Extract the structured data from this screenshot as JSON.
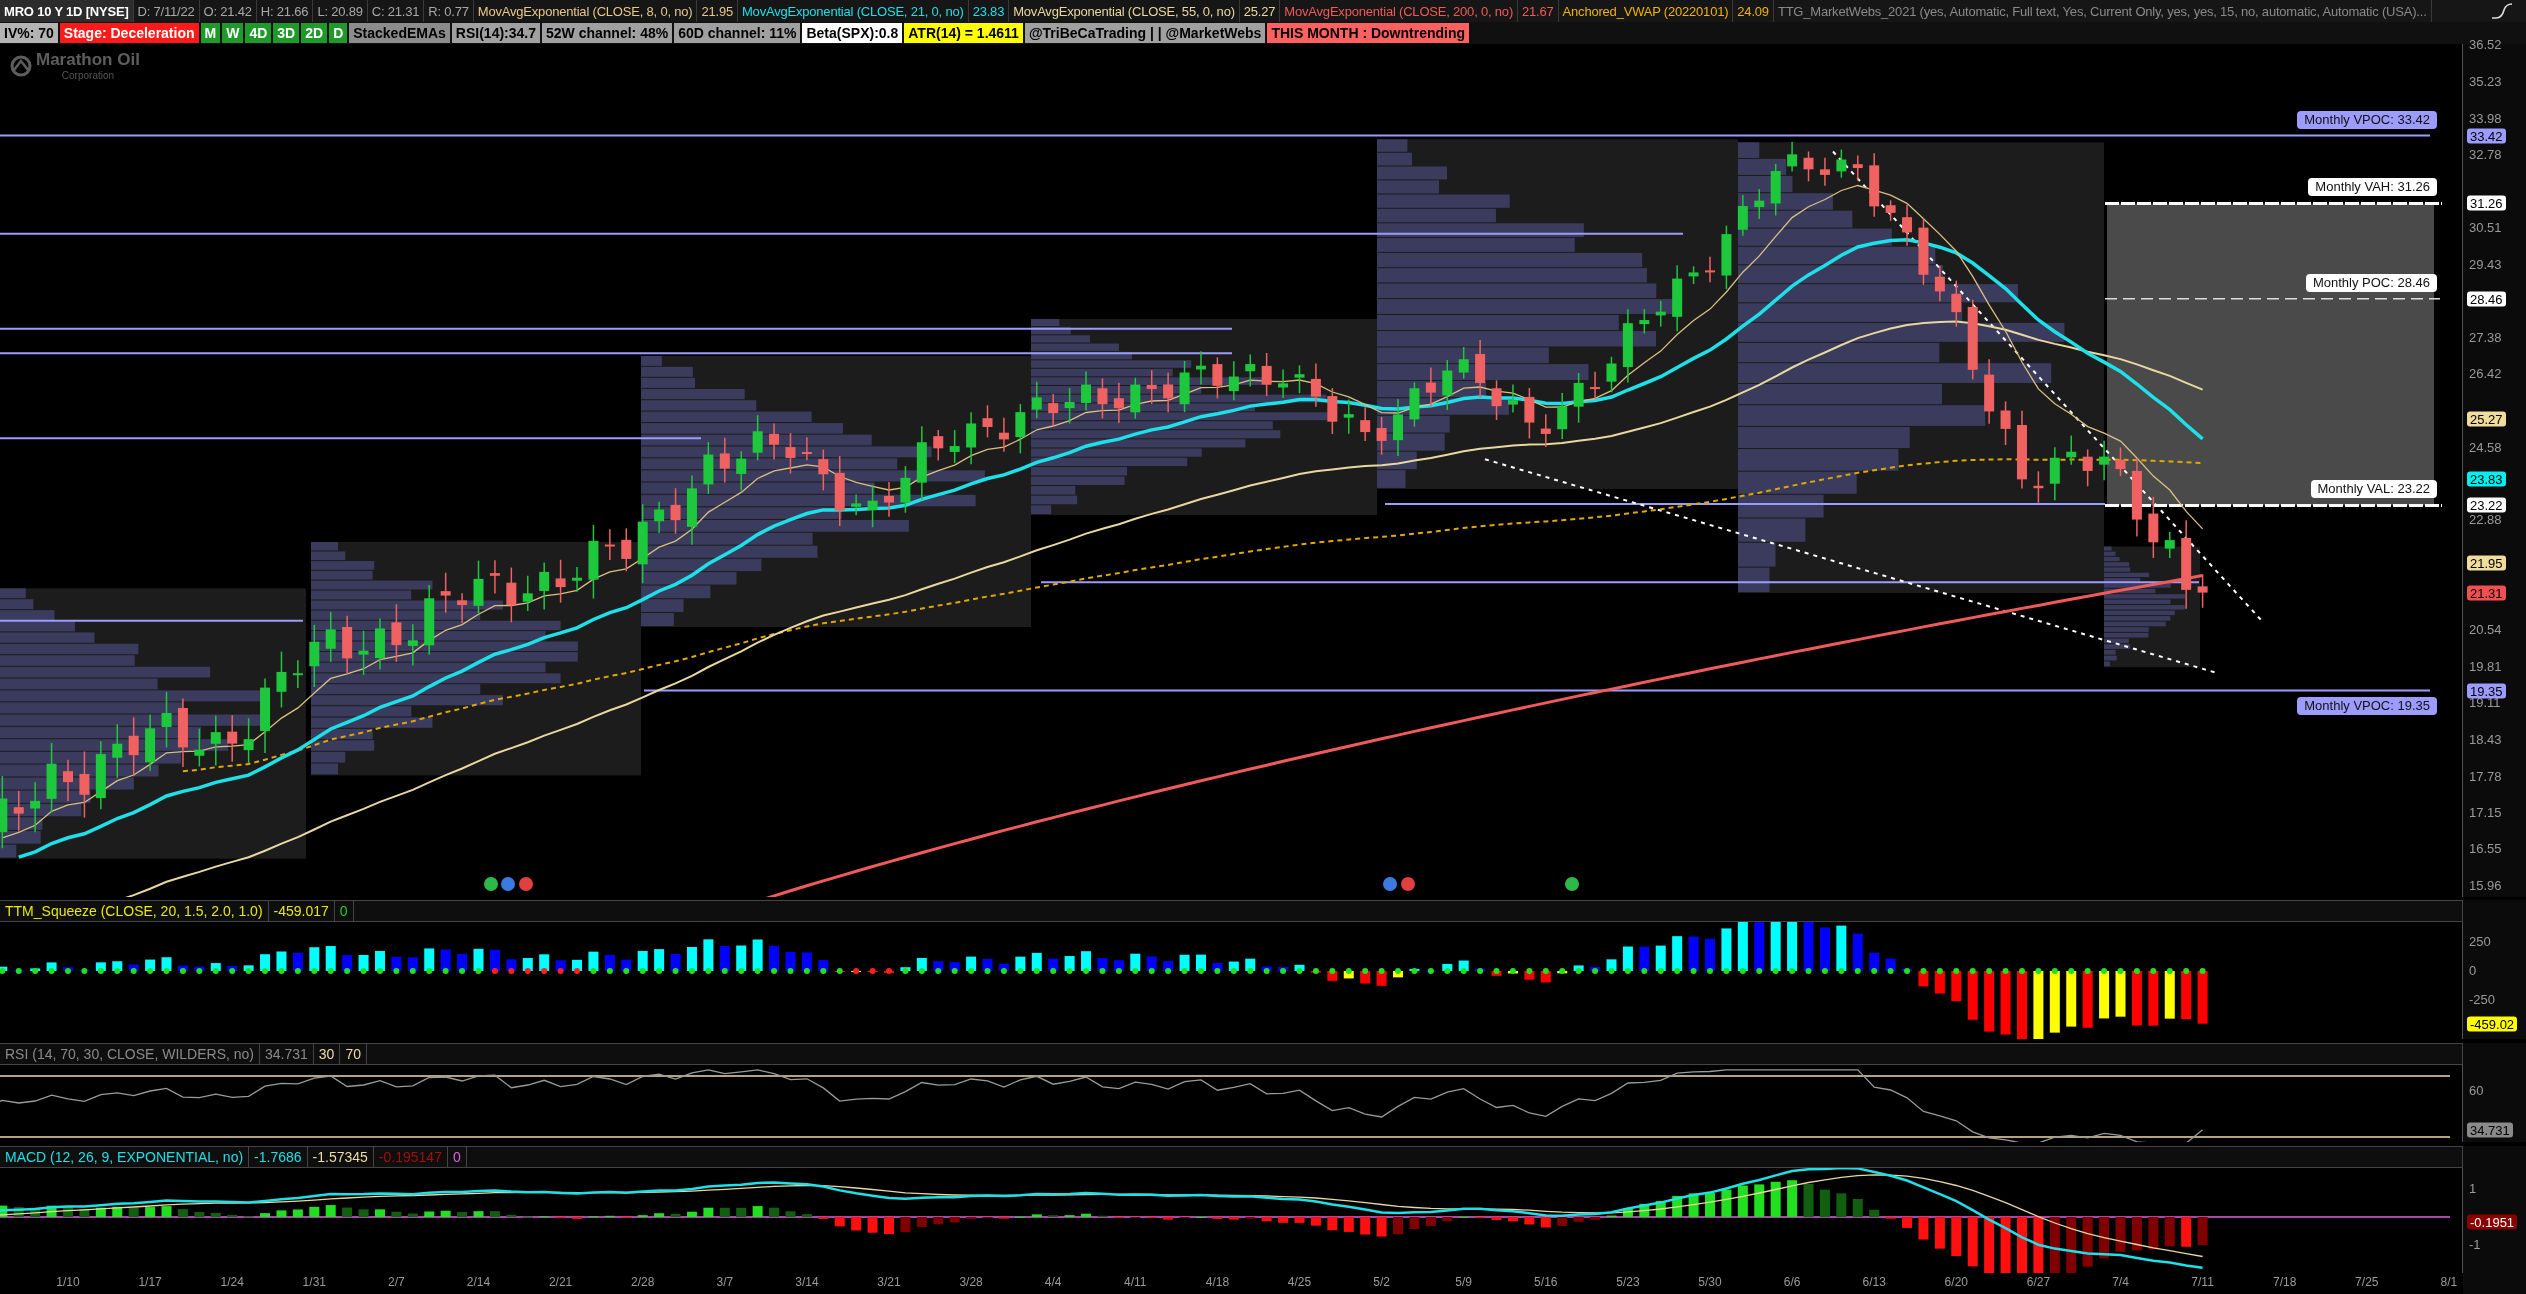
{
  "header": {
    "symbol": "MRO 10 Y 1D [NYSE]",
    "quote": [
      "D: 7/11/22",
      "O: 21.42",
      "H: 21.66",
      "L: 20.89",
      "C: 21.31",
      "R: 0.77"
    ],
    "studies": [
      {
        "label": "MovAvgExponential (CLOSE, 8, 0, no)",
        "value": "21.95",
        "color": "#e6c88a"
      },
      {
        "label": "MovAvgExponential (CLOSE, 21, 0, no)",
        "value": "23.83",
        "color": "#1ee0e8"
      },
      {
        "label": "MovAvgExponential (CLOSE, 55, 0, no)",
        "value": "25.27",
        "color": "#e8d8a0"
      },
      {
        "label": "MovAvgExponential (CLOSE, 200, 0, no)",
        "value": "21.67",
        "color": "#f05a5a"
      },
      {
        "label": "Anchored_VWAP (20220101)",
        "value": "24.09",
        "color": "#f0b400"
      },
      {
        "label": "TTG_MarketWebs_2021 (yes, Automatic, Full text, Yes, Current Only, yes, yes, 15, no, automatic, Automatic (USA)...",
        "color": "#8a8a8a"
      }
    ],
    "badges": [
      {
        "text": "IV%: 70",
        "color": "#b4b4b4"
      },
      {
        "text": "Stage: Deceleration",
        "color": "#ff1a1a"
      },
      {
        "text": "M",
        "color": "#1f9a2a"
      },
      {
        "text": "W",
        "color": "#1f9a2a"
      },
      {
        "text": "4D",
        "color": "#1f9a2a"
      },
      {
        "text": "3D",
        "color": "#1f9a2a"
      },
      {
        "text": "2D",
        "color": "#1f9a2a"
      },
      {
        "text": "D",
        "color": "#1f9a2a"
      },
      {
        "text": "StackedEMAs",
        "color": "#8c8c8c"
      },
      {
        "text": "RSI(14):34.7",
        "color": "#a0a0a0"
      },
      {
        "text": "52W channel: 48%",
        "color": "#a0a0a0"
      },
      {
        "text": "60D channel: 11%",
        "color": "#a0a0a0"
      },
      {
        "text": "Beta(SPX):0.8",
        "color": "#ffffff"
      },
      {
        "text": "ATR(14) = 1.4611",
        "color": "#ffff00"
      },
      {
        "text": "@TriBeCaTrading | | @MarketWebs",
        "color": "#a0a0a0"
      },
      {
        "text": "THIS MONTH : Downtrending",
        "color": "#ff6060"
      }
    ]
  },
  "logo": {
    "name": "Marathon Oil",
    "subtitle": "Corporation"
  },
  "annotations": [
    {
      "text": "Monthly VPOC: 33.42",
      "kind": "above",
      "color": "#9c9cff"
    },
    {
      "text": "Monthly VAH: 31.26",
      "kind": "above",
      "color": "#ffffff"
    },
    {
      "text": "Monthly POC: 28.46",
      "kind": "above",
      "color": "#ffffff"
    },
    {
      "text": "Monthly VAL: 23.22",
      "kind": "above",
      "color": "#ffffff"
    },
    {
      "text": "Monthly VPOC: 19.35",
      "kind": "below",
      "color": "#9c9cff"
    }
  ],
  "price_axis": {
    "ticks": [
      "36.52",
      "35.23",
      "33.98",
      "32.78",
      "30.51",
      "29.43",
      "27.38",
      "26.42",
      "24.58",
      "22.88",
      "20.54",
      "19.81",
      "19.11",
      "18.43",
      "17.78",
      "17.15",
      "16.55",
      "15.96"
    ],
    "badges": [
      {
        "text": "33.42",
        "color": "#9c9cff"
      },
      {
        "text": "31.26",
        "color": "#ffffff"
      },
      {
        "text": "28.46",
        "color": "#ffffff"
      },
      {
        "text": "25.27",
        "color": "#f0dc9c"
      },
      {
        "text": "23.83",
        "color": "#00f0f0"
      },
      {
        "text": "23.22",
        "color": "#ffffff"
      },
      {
        "text": "21.95",
        "color": "#f0dc9c"
      },
      {
        "text": "21.31",
        "color": "#f05050"
      },
      {
        "text": "19.35",
        "color": "#9c9cff"
      }
    ]
  },
  "squeeze": {
    "title": "TTM_Squeeze (CLOSE, 20, 1.5, 2.0, 1.0)",
    "values": [
      {
        "text": "-459.017",
        "color": "#e8e800"
      },
      {
        "text": "0",
        "color": "#20d020"
      }
    ],
    "ticks": [
      "250",
      "0",
      "-250"
    ],
    "badge": {
      "text": "-459.02",
      "color": "#ffff00"
    }
  },
  "rsi": {
    "title": "RSI (14, 70, 30, CLOSE, WILDERS, no)",
    "values": [
      {
        "text": "34.731",
        "color": "#8a8a8a"
      },
      {
        "text": "30",
        "color": "#f0dcaa"
      },
      {
        "text": "70",
        "color": "#f0dcaa"
      }
    ],
    "ticks": [
      "60"
    ],
    "badge": {
      "text": "34.731",
      "color": "#8a8a8a"
    }
  },
  "macd": {
    "title": "MACD (12, 26, 9, EXPONENTIAL, no)",
    "values": [
      {
        "text": "-1.7686",
        "color": "#1ee0e8"
      },
      {
        "text": "-1.57345",
        "color": "#f0dcaa"
      },
      {
        "text": "-0.195147",
        "color": "#a01010"
      },
      {
        "text": "0",
        "color": "#e060e0"
      }
    ],
    "ticks": [
      "1",
      "-1"
    ],
    "badge": {
      "text": "-0.1951",
      "color": "#8a0000"
    }
  },
  "dates": [
    "1/10",
    "1/17",
    "1/24",
    "1/31",
    "2/7",
    "2/14",
    "2/21",
    "2/28",
    "3/7",
    "3/14",
    "3/21",
    "3/28",
    "4/4",
    "4/11",
    "4/18",
    "4/25",
    "5/2",
    "5/9",
    "5/16",
    "5/23",
    "5/30",
    "6/6",
    "6/13",
    "6/20",
    "6/27",
    "7/4",
    "7/11",
    "7/18",
    "7/25",
    "8/1"
  ]
}
